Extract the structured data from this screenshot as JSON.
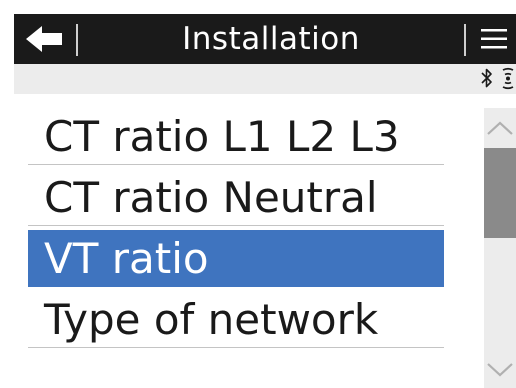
{
  "header": {
    "title": "Installation",
    "back_icon": "arrow-left-icon",
    "menu_icon": "hamburger-menu-icon"
  },
  "status": {
    "icons": [
      "bluetooth-icon",
      "wireless-signal-icon"
    ]
  },
  "menu": {
    "items": [
      {
        "label": "CT ratio L1 L2 L3",
        "selected": false
      },
      {
        "label": "CT ratio Neutral",
        "selected": false
      },
      {
        "label": "VT ratio",
        "selected": true
      },
      {
        "label": "Type of network",
        "selected": false
      }
    ]
  },
  "scrollbar": {
    "position_fraction": 0.15,
    "visible_fraction": 0.32
  },
  "colors": {
    "header_bg": "#1a1a1a",
    "selection": "#3f74bf",
    "strip_bg": "#ececec",
    "scroll_thumb": "#8a8a8a"
  }
}
